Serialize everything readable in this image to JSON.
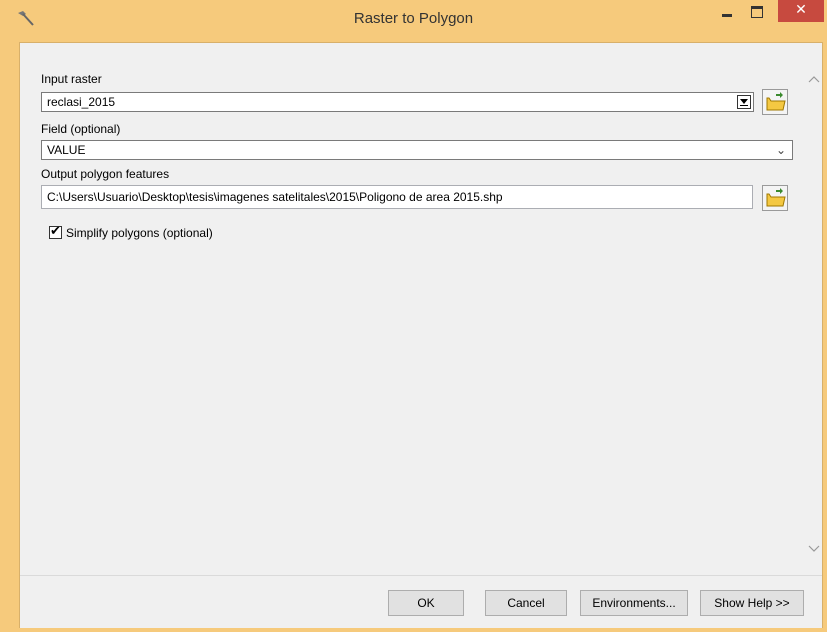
{
  "window": {
    "title": "Raster to Polygon"
  },
  "form": {
    "input_raster": {
      "label": "Input raster",
      "value": "reclasi_2015"
    },
    "field": {
      "label": "Field (optional)",
      "value": "VALUE"
    },
    "output": {
      "label": "Output polygon features",
      "value": "C:\\Users\\Usuario\\Desktop\\tesis\\imagenes satelitales\\2015\\Poligono de area 2015.shp"
    },
    "simplify": {
      "label": "Simplify polygons (optional)",
      "checked": true
    }
  },
  "buttons": {
    "ok": "OK",
    "cancel": "Cancel",
    "environments": "Environments...",
    "show_help": "Show Help >>"
  },
  "icons": {
    "app": "hammer-icon",
    "folder": "open-folder-icon"
  },
  "colors": {
    "titlebar": "#f6ca7c",
    "close": "#c74a3f",
    "client": "#f0f0f0"
  }
}
